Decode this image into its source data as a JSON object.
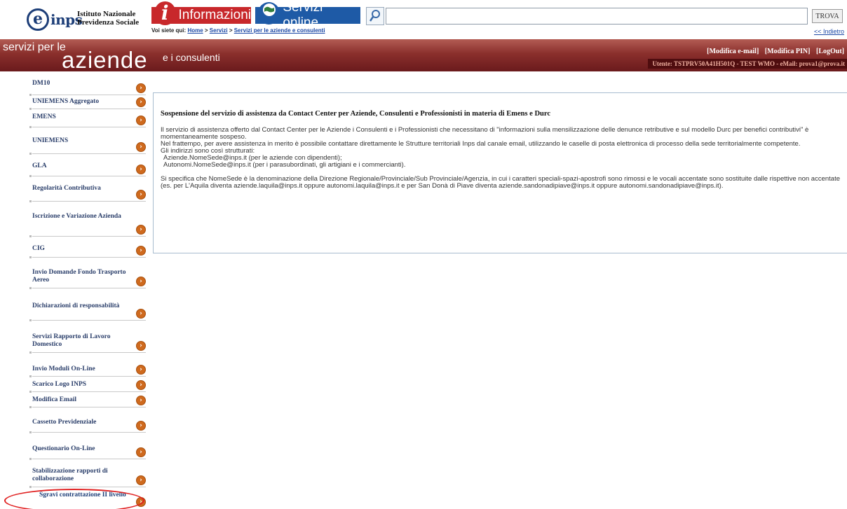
{
  "header": {
    "logo_letter": "e",
    "logo_text": "inps",
    "org_line1": "Istituto Nazionale",
    "org_line2": "Previdenza Sociale",
    "tab_info": "Informazioni",
    "tab_servizi": "Servizi online",
    "search_button": "TROVA",
    "search_value": "",
    "breadcrumb_prefix": "Voi siete qui:",
    "breadcrumb": [
      "Home",
      "Servizi",
      "Servizi per le aziende e consulenti"
    ],
    "back_link": "<< Indietro"
  },
  "banner": {
    "line1": "servizi per le",
    "line2": "aziende",
    "line3": "e i consulenti",
    "links": [
      "[Modifica e-mail]",
      "[Modifica PIN]",
      "[LogOut]"
    ],
    "user": "Utente: TSTPRV50A41H501Q - TEST WMO - eMail: prova1@prova.it"
  },
  "sidebar": {
    "items": [
      "DM10",
      "UNIEMENS Aggregato",
      "EMENS",
      "UNIEMENS",
      "GLA",
      "Regolarità Contributiva",
      "Iscrizione e Variazione Azienda",
      "CIG",
      "Invio Domande Fondo Trasporto Aereo",
      "Dichiarazioni di responsabilità",
      "Servizi Rapporto di Lavoro Domestico",
      "Invio Moduli On-Line",
      "Scarico Logo INPS",
      "Modifica Email",
      "Cassetto Previdenziale",
      "Questionario On-Line",
      "Stabilizzazione rapporti di collaborazione",
      "Sgravi contrattazione II livello"
    ]
  },
  "notice": {
    "title": "Sospensione del servizio di assistenza da Contact Center per Aziende, Consulenti e Professionisti in materia di Emens e Durc",
    "p1": "Il servizio di assistenza offerto dal Contact Center per le Aziende i Consulenti e i Professionisti che necessitano di \"informazioni sulla mensilizzazione delle denunce retributive e sul modello Durc per benefici contributivi\" è momentaneamente sospeso.",
    "p2": "Nel frattempo, per avere assistenza in merito è possibile contattare direttamente le Strutture territoriali Inps dal canale email, utilizzando le caselle di posta elettronica di processo della sede territorialmente competente.",
    "p3": "Gli indirizzi sono così strutturati:",
    "p4": "Aziende.NomeSede@inps.it (per le aziende con dipendenti);",
    "p5": "Autonomi.NomeSede@inps.it (per i parasubordinati, gli artigiani e i commercianti).",
    "p6": "Si specifica che NomeSede è la denominazione della Direzione Regionale/Provinciale/Sub Provinciale/Agenzia, in cui i caratteri speciali-spazi-apostrofi sono rimossi e le vocali accentate sono sostituite dalle rispettive non accentate",
    "p7": "(es. per L'Aquila diventa aziende.laquila@inps.it oppure autonomi.laquila@inps.it e per San Donà di Piave diventa aziende.sandonadipiave@inps.it oppure autonomi.sandonadipiave@inps.it)."
  },
  "colors": {
    "info_tab": "#c8282b",
    "servizi_tab": "#1e5aa6",
    "banner": "#8a2f2c",
    "arrow": "#cf6a1e",
    "highlight": "#e02020"
  }
}
